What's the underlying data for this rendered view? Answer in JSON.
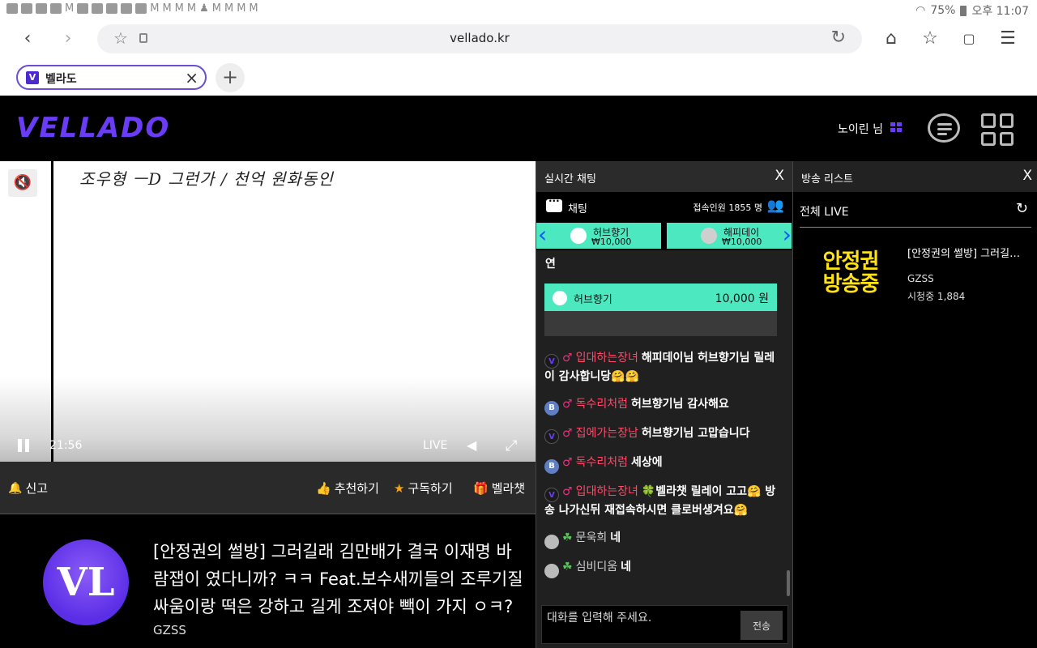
{
  "status_bar": {
    "battery": "75%",
    "time": "오후 11:07"
  },
  "browser": {
    "url": "vellado.kr",
    "tab_title": "벨라도",
    "tab_favicon": "V"
  },
  "site": {
    "logo": "VELLADO",
    "user_label": "노이린 님"
  },
  "video": {
    "overlay_text": "조우형 ㅡD 그런가 / 천억 원화동인",
    "time": "21:56",
    "live": "LIVE"
  },
  "actions": {
    "report": "신고",
    "recommend": "추천하기",
    "subscribe": "구독하기",
    "vellachat": "벨라챗"
  },
  "stream": {
    "avatar_text": "VL",
    "title": "[안정권의 썰방] 그러길래 김만배가 결국 이재명 바람잽이 였다니까? ㅋㅋ Feat.보수새끼들의 조루기질 싸움이랑 떡은 강하고 길게 조져야 빽이 가지 ㅇㅋ?",
    "channel": "GZSS"
  },
  "chat": {
    "header": "실시간 채팅",
    "close": "X",
    "sub_label": "채팅",
    "viewers": "접속인원 1855 명",
    "donors": [
      {
        "name": "허브향기",
        "amount": "₩10,000"
      },
      {
        "name": "해피데이",
        "amount": "₩10,000"
      }
    ],
    "fragment": "연",
    "donation": {
      "name": "허브향기",
      "amount": "10,000 원"
    },
    "messages": [
      {
        "badge": "V",
        "nick": "입대하는장녀",
        "text": "해피데이님 허브향기님 릴레이 감사합니당🤗🤗"
      },
      {
        "badge": "B",
        "nick": "독수리처럼",
        "text": "허브향기님 감사해요"
      },
      {
        "badge": "V",
        "nick": "집에가는장남",
        "text": "허브향기님 고맙습니다"
      },
      {
        "badge": "B",
        "nick": "독수리처럼",
        "text": "세상에"
      },
      {
        "badge": "V",
        "nick": "입대하는장녀",
        "text": "🍀벨라챗 릴레이 고고🤗 방송 나가신뒤 재접속하시면 클로버생겨요🤗"
      },
      {
        "badge": "G",
        "nick": "문욱희",
        "text": "네"
      },
      {
        "badge": "G",
        "nick": "심비디움",
        "text": "네"
      }
    ],
    "input_placeholder": "대화를 입력해 주세요.",
    "send": "전송"
  },
  "broadcast_list": {
    "header": "방송 리스트",
    "close": "X",
    "tab": "전체 LIVE",
    "items": [
      {
        "thumb": "안정권\n방송중",
        "title": "[안정권의 썰방] 그러길래 김만배가 결국 이재명 바람잽이",
        "channel": "GZSS",
        "viewers": "시청중 1,884"
      }
    ]
  }
}
